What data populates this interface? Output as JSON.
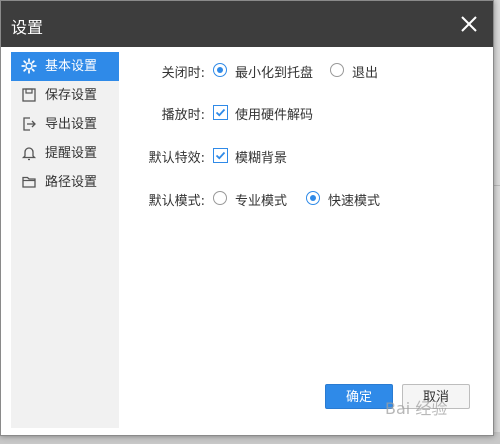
{
  "dialog": {
    "title": "设置",
    "close_icon": "close-icon"
  },
  "sidebar": {
    "items": [
      {
        "label": "基本设置",
        "icon": "gear-icon",
        "active": true
      },
      {
        "label": "保存设置",
        "icon": "save-icon",
        "active": false
      },
      {
        "label": "导出设置",
        "icon": "export-icon",
        "active": false
      },
      {
        "label": "提醒设置",
        "icon": "bell-icon",
        "active": false
      },
      {
        "label": "路径设置",
        "icon": "folder-icon",
        "active": false
      }
    ]
  },
  "settings": {
    "close_action": {
      "label": "关闭时:",
      "options": [
        {
          "label": "最小化到托盘",
          "selected": true
        },
        {
          "label": "退出",
          "selected": false
        }
      ]
    },
    "playback": {
      "label": "播放时:",
      "checkbox_label": "使用硬件解码",
      "checked": true
    },
    "default_effect": {
      "label": "默认特效:",
      "checkbox_label": "模糊背景",
      "checked": true
    },
    "default_mode": {
      "label": "默认模式:",
      "options": [
        {
          "label": "专业模式",
          "selected": false
        },
        {
          "label": "快速模式",
          "selected": true
        }
      ]
    }
  },
  "buttons": {
    "ok_label": "确定",
    "cancel_label": "取消"
  },
  "watermark": {
    "text": "Bai 经验"
  },
  "colors": {
    "accent": "#2f8ae8",
    "titlebar": "#3d3d3d",
    "sidebar_bg": "#f1f1f1"
  }
}
